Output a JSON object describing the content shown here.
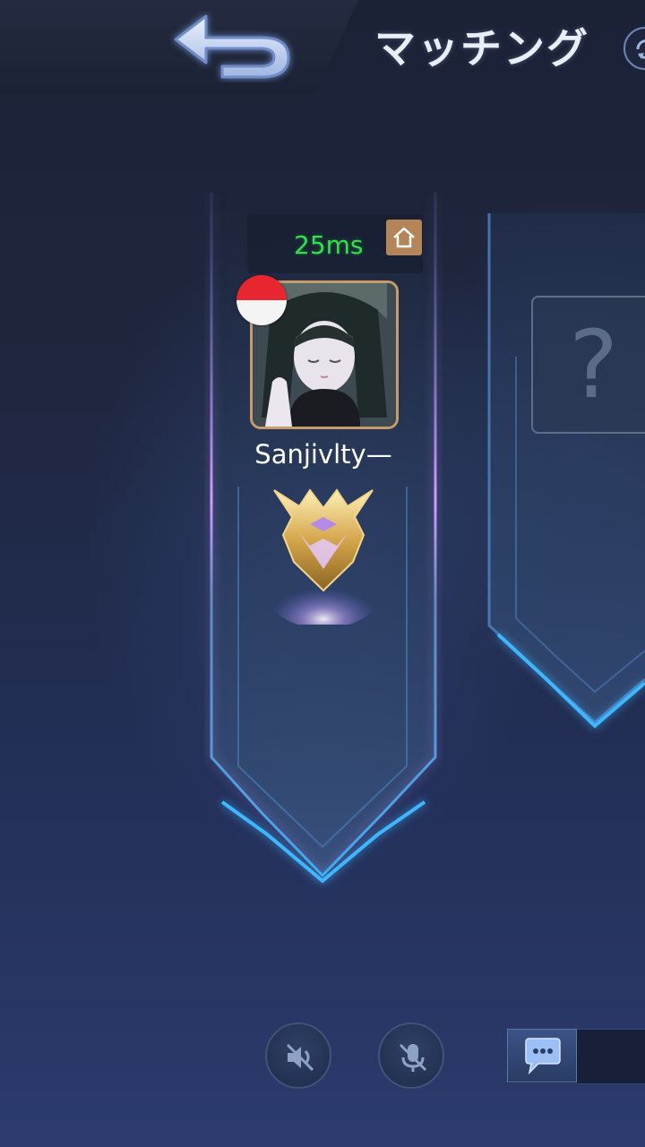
{
  "header": {
    "title": "マッチング",
    "back_icon": "back-arrow-icon",
    "refresh_icon": "refresh-icon"
  },
  "player": {
    "ping": "25ms",
    "ping_color": "#33e04a",
    "name": "Sanjivlty—",
    "country_flag": "flag-indonesia-icon",
    "avatar": "anime-girl-avatar",
    "rank_emblem": "mythic-rank-emblem-icon",
    "home_icon": "home-icon"
  },
  "empty_slot": {
    "placeholder": "?"
  },
  "controls": {
    "speaker_icon": "speaker-muted-icon",
    "mic_icon": "mic-muted-icon",
    "chat_icon": "chat-bubble-icon"
  },
  "colors": {
    "accent_blue": "#3fb6ff",
    "frame_gold": "#c89b6a",
    "glow_purple": "#c77dff"
  }
}
